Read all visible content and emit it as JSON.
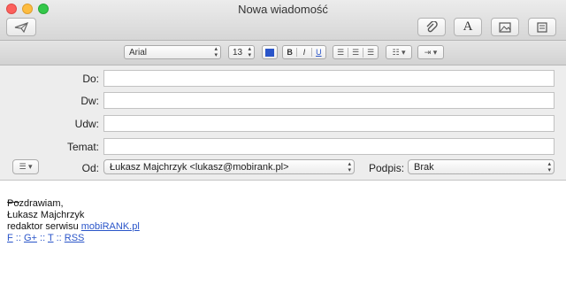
{
  "window": {
    "title": "Nowa wiadomość"
  },
  "toolbar": {
    "font_label": "A",
    "font_family": "Arial",
    "font_size": "13",
    "bold": "B",
    "italic": "I",
    "underline": "U",
    "text_color": "#2a55c9"
  },
  "header": {
    "to_label": "Do:",
    "cc_label": "Dw:",
    "bcc_label": "Udw:",
    "subject_label": "Temat:",
    "from_label": "Od:",
    "from_value": "Łukasz Majchrzyk <lukasz@mobirank.pl>",
    "signature_label": "Podpis:",
    "signature_value": "Brak"
  },
  "body": {
    "greeting": "Pozdrawiam,",
    "name": "Łukasz Majchrzyk",
    "role_prefix": "redaktor serwisu ",
    "site_link": "mobiRANK.pl",
    "links": [
      "F",
      "G+",
      "T",
      "RSS"
    ],
    "separator": " :: "
  }
}
